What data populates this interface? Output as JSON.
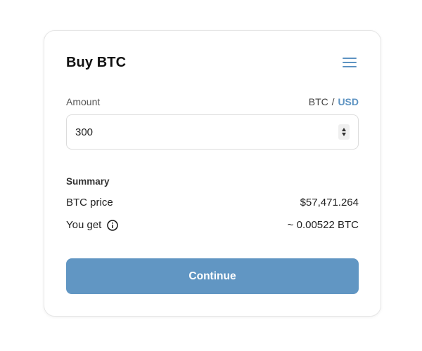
{
  "card": {
    "title": "Buy BTC",
    "menu_icon": "hamburger-menu-icon"
  },
  "amount": {
    "label": "Amount",
    "currency_toggle": {
      "option_btc": "BTC",
      "separator": "/",
      "option_usd": "USD",
      "active": "USD"
    },
    "value": "300",
    "stepper_icons": [
      "increment-arrow-icon",
      "decrement-arrow-icon"
    ]
  },
  "summary": {
    "heading": "Summary",
    "rows": [
      {
        "label": "BTC price",
        "value": "$57,471.264"
      },
      {
        "label": "You get",
        "value": "~ 0.00522 BTC",
        "icon": "info-icon"
      }
    ]
  },
  "actions": {
    "continue_label": "Continue"
  },
  "colors": {
    "accent": "#5d93c2",
    "button": "#6196c3",
    "border": "#dcdcdc"
  }
}
